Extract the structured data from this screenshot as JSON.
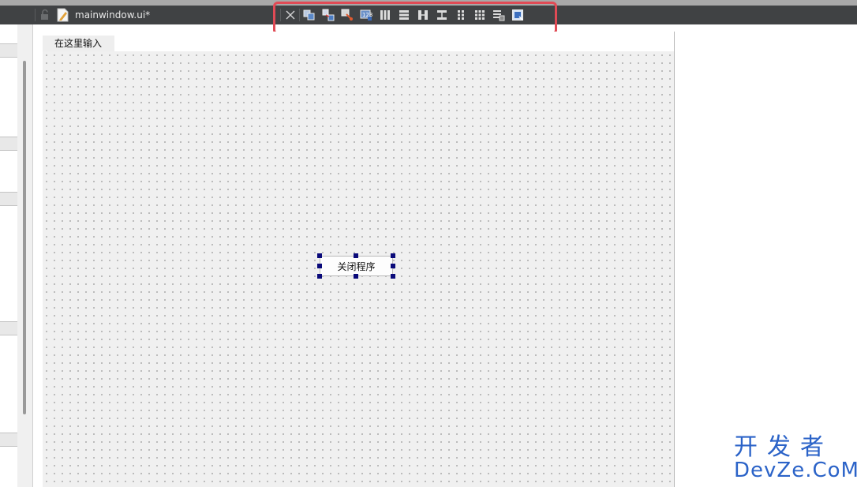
{
  "editor": {
    "file_title": "mainwindow.ui*"
  },
  "toolbar": {
    "icons": [
      "close-icon",
      "edit-widgets-icon",
      "edit-signals-slots-icon",
      "edit-buddies-icon",
      "edit-tab-order-icon",
      "layout-horizontal-icon",
      "layout-vertical-icon",
      "layout-horizontal-splitter-icon",
      "layout-vertical-splitter-icon",
      "layout-form-icon",
      "layout-grid-icon",
      "break-layout-icon",
      "adjust-size-icon"
    ]
  },
  "form": {
    "menu_item": "在这里输入",
    "button_label": "关闭程序"
  },
  "watermark": {
    "cn": "开发者",
    "en": "DevZe.CoM"
  },
  "colors": {
    "toolbar_bg": "#404244",
    "highlight": "#e04a55",
    "handle": "#0a0a7a",
    "watermark": "#2b63c8"
  }
}
